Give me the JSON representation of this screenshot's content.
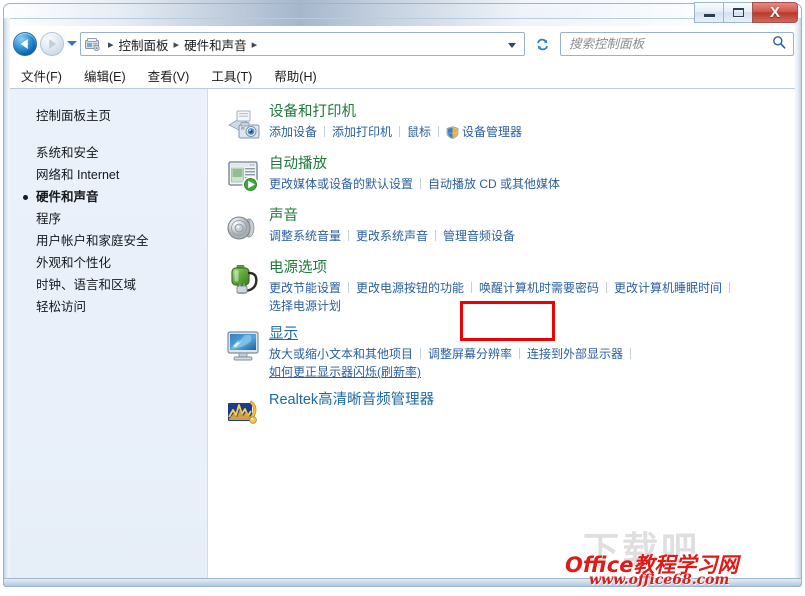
{
  "window": {
    "buttons": {
      "minimize": "—",
      "maximize": "□",
      "close": "X"
    }
  },
  "nav": {
    "back_label": "后退",
    "forward_label": "前进",
    "history_label": "最近浏览的位置",
    "refresh_label": "刷新",
    "breadcrumb_icon": "control-panel-icon",
    "breadcrumbs": [
      "控制面板",
      "硬件和声音"
    ],
    "separator": "▸"
  },
  "search": {
    "placeholder": "搜索控制面板",
    "value": "",
    "icon": "search-icon"
  },
  "menubar": {
    "items": [
      {
        "label": "文件(F)"
      },
      {
        "label": "编辑(E)"
      },
      {
        "label": "查看(V)"
      },
      {
        "label": "工具(T)"
      },
      {
        "label": "帮助(H)"
      }
    ]
  },
  "sidebar": {
    "home": "控制面板主页",
    "items": [
      {
        "label": "系统和安全",
        "current": false
      },
      {
        "label": "网络和 Internet",
        "current": false
      },
      {
        "label": "硬件和声音",
        "current": true
      },
      {
        "label": "程序",
        "current": false
      },
      {
        "label": "用户帐户和家庭安全",
        "current": false
      },
      {
        "label": "外观和个性化",
        "current": false
      },
      {
        "label": "时钟、语言和区域",
        "current": false
      },
      {
        "label": "轻松访问",
        "current": false
      }
    ]
  },
  "categories": [
    {
      "id": "devices-and-printers",
      "icon": "printer-camera-icon",
      "title": "设备和打印机",
      "title_color": "green",
      "links_rows": [
        [
          {
            "label": "添加设备",
            "shield": false
          },
          {
            "label": "添加打印机",
            "shield": false
          },
          {
            "label": "鼠标",
            "shield": false
          },
          {
            "label": "设备管理器",
            "shield": true
          }
        ]
      ]
    },
    {
      "id": "autoplay",
      "icon": "autoplay-icon",
      "title": "自动播放",
      "title_color": "green",
      "links_rows": [
        [
          {
            "label": "更改媒体或设备的默认设置",
            "shield": false
          },
          {
            "label": "自动播放 CD 或其他媒体",
            "shield": false
          }
        ]
      ]
    },
    {
      "id": "sound",
      "icon": "speaker-icon",
      "title": "声音",
      "title_color": "green",
      "links_rows": [
        [
          {
            "label": "调整系统音量",
            "shield": false
          },
          {
            "label": "更改系统声音",
            "shield": false
          },
          {
            "label": "管理音频设备",
            "shield": false,
            "highlighted": true
          }
        ]
      ]
    },
    {
      "id": "power-options",
      "icon": "battery-plug-icon",
      "title": "电源选项",
      "title_color": "green",
      "links_rows": [
        [
          {
            "label": "更改节能设置",
            "shield": false
          },
          {
            "label": "更改电源按钮的功能",
            "shield": false
          },
          {
            "label": "唤醒计算机时需要密码",
            "shield": false
          },
          {
            "label": "更改计算机睡眠时间",
            "shield": false
          },
          {
            "label": "",
            "shield": false
          }
        ],
        [
          {
            "label": "选择电源计划",
            "shield": false
          }
        ]
      ]
    },
    {
      "id": "display",
      "icon": "monitor-icon",
      "title": "显示",
      "title_color": "blue",
      "title_underlined": true,
      "links_rows": [
        [
          {
            "label": "放大或缩小文本和其他项目",
            "shield": false
          },
          {
            "label": "调整屏幕分辨率",
            "shield": false
          },
          {
            "label": "连接到外部显示器",
            "shield": false
          },
          {
            "label": "",
            "shield": false
          }
        ],
        [
          {
            "label": "如何更正显示器闪烁(刷新率)",
            "shield": false,
            "underlined": true
          }
        ]
      ]
    },
    {
      "id": "realtek-hd-audio-manager",
      "icon": "realtek-audio-icon",
      "title": "Realtek高清晰音频管理器",
      "title_color": "blue",
      "links_rows": []
    }
  ],
  "annotation": {
    "highlight_color": "#ef0000",
    "target": "管理音频设备"
  },
  "watermark": {
    "ghost": "下载吧",
    "main": "Office教程学习网",
    "url": "www.office68.com"
  }
}
